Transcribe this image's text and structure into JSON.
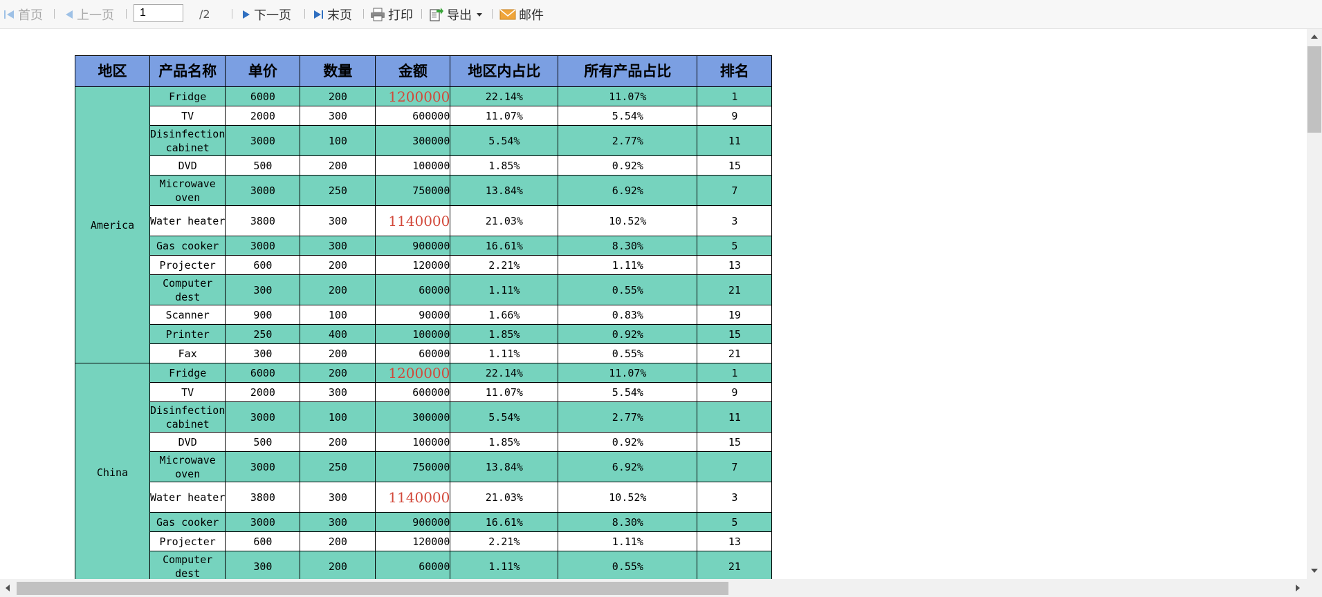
{
  "toolbar": {
    "first_label": "首页",
    "prev_label": "上一页",
    "page_value": "1",
    "page_total": "/2",
    "next_label": "下一页",
    "last_label": "末页",
    "print_label": "打印",
    "export_label": "导出",
    "mail_label": "邮件"
  },
  "table": {
    "headers": [
      "地区",
      "产品名称",
      "单价",
      "数量",
      "金额",
      "地区内占比",
      "所有产品占比",
      "排名"
    ],
    "regions": [
      {
        "name": "America",
        "rows": [
          {
            "product": "Fridge",
            "price": "6000",
            "qty": "200",
            "amount": "1200000",
            "region_pct": "22.14%",
            "all_pct": "11.07%",
            "rank": "1"
          },
          {
            "product": "TV",
            "price": "2000",
            "qty": "300",
            "amount": "600000",
            "region_pct": "11.07%",
            "all_pct": "5.54%",
            "rank": "9"
          },
          {
            "product": "Disinfection cabinet",
            "price": "3000",
            "qty": "100",
            "amount": "300000",
            "region_pct": "5.54%",
            "all_pct": "2.77%",
            "rank": "11"
          },
          {
            "product": "DVD",
            "price": "500",
            "qty": "200",
            "amount": "100000",
            "region_pct": "1.85%",
            "all_pct": "0.92%",
            "rank": "15"
          },
          {
            "product": "Microwave oven",
            "price": "3000",
            "qty": "250",
            "amount": "750000",
            "region_pct": "13.84%",
            "all_pct": "6.92%",
            "rank": "7"
          },
          {
            "product": "Water heater",
            "price": "3800",
            "qty": "300",
            "amount": "1140000",
            "region_pct": "21.03%",
            "all_pct": "10.52%",
            "rank": "3"
          },
          {
            "product": "Gas cooker",
            "price": "3000",
            "qty": "300",
            "amount": "900000",
            "region_pct": "16.61%",
            "all_pct": "8.30%",
            "rank": "5"
          },
          {
            "product": "Projecter",
            "price": "600",
            "qty": "200",
            "amount": "120000",
            "region_pct": "2.21%",
            "all_pct": "1.11%",
            "rank": "13"
          },
          {
            "product": "Computer dest",
            "price": "300",
            "qty": "200",
            "amount": "60000",
            "region_pct": "1.11%",
            "all_pct": "0.55%",
            "rank": "21"
          },
          {
            "product": "Scanner",
            "price": "900",
            "qty": "100",
            "amount": "90000",
            "region_pct": "1.66%",
            "all_pct": "0.83%",
            "rank": "19"
          },
          {
            "product": "Printer",
            "price": "250",
            "qty": "400",
            "amount": "100000",
            "region_pct": "1.85%",
            "all_pct": "0.92%",
            "rank": "15"
          },
          {
            "product": "Fax",
            "price": "300",
            "qty": "200",
            "amount": "60000",
            "region_pct": "1.11%",
            "all_pct": "0.55%",
            "rank": "21"
          }
        ]
      },
      {
        "name": "China",
        "rows": [
          {
            "product": "Fridge",
            "price": "6000",
            "qty": "200",
            "amount": "1200000",
            "region_pct": "22.14%",
            "all_pct": "11.07%",
            "rank": "1"
          },
          {
            "product": "TV",
            "price": "2000",
            "qty": "300",
            "amount": "600000",
            "region_pct": "11.07%",
            "all_pct": "5.54%",
            "rank": "9"
          },
          {
            "product": "Disinfection cabinet",
            "price": "3000",
            "qty": "100",
            "amount": "300000",
            "region_pct": "5.54%",
            "all_pct": "2.77%",
            "rank": "11"
          },
          {
            "product": "DVD",
            "price": "500",
            "qty": "200",
            "amount": "100000",
            "region_pct": "1.85%",
            "all_pct": "0.92%",
            "rank": "15"
          },
          {
            "product": "Microwave oven",
            "price": "3000",
            "qty": "250",
            "amount": "750000",
            "region_pct": "13.84%",
            "all_pct": "6.92%",
            "rank": "7"
          },
          {
            "product": "Water heater",
            "price": "3800",
            "qty": "300",
            "amount": "1140000",
            "region_pct": "21.03%",
            "all_pct": "10.52%",
            "rank": "3"
          },
          {
            "product": "Gas cooker",
            "price": "3000",
            "qty": "300",
            "amount": "900000",
            "region_pct": "16.61%",
            "all_pct": "8.30%",
            "rank": "5"
          },
          {
            "product": "Projecter",
            "price": "600",
            "qty": "200",
            "amount": "120000",
            "region_pct": "2.21%",
            "all_pct": "1.11%",
            "rank": "13"
          },
          {
            "product": "Computer dest",
            "price": "300",
            "qty": "200",
            "amount": "60000",
            "region_pct": "1.11%",
            "all_pct": "0.55%",
            "rank": "21"
          }
        ]
      }
    ]
  },
  "colors": {
    "header_bg": "#7b9fe2",
    "row_green": "#76d3be",
    "highlight_text": "#d2483a"
  }
}
